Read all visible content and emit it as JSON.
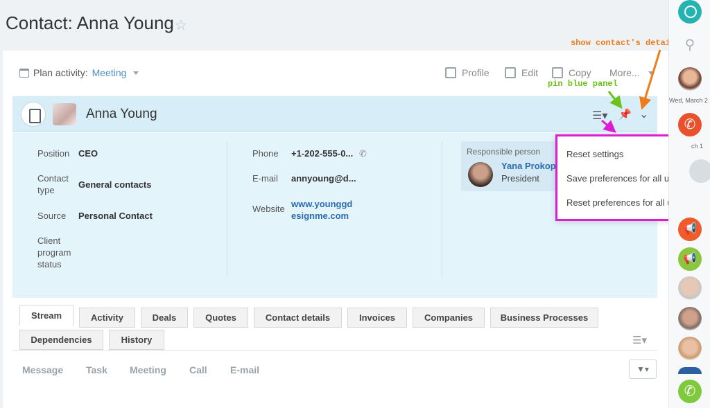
{
  "page": {
    "title": "Contact: Anna Young",
    "star_icon": "star-icon"
  },
  "toolbar": {
    "plan_prefix": "Plan activity:",
    "plan_value": "Meeting",
    "profile": "Profile",
    "edit": "Edit",
    "copy": "Copy",
    "more": "More..."
  },
  "annotations": {
    "show_details": "show contact's details",
    "pin_panel": "pin blue panel",
    "orange": "#f07b18",
    "green": "#6ac21b",
    "magenta": "#e01bd6"
  },
  "header": {
    "name": "Anna Young"
  },
  "details": {
    "position_label": "Position",
    "position_value": "CEO",
    "contact_type_label_1": "Contact",
    "contact_type_label_2": "type",
    "contact_type_value": "General contacts",
    "source_label": "Source",
    "source_value": "Personal Contact",
    "client_label_1": "Client",
    "client_label_2": "program",
    "client_label_3": "status",
    "phone_label": "Phone",
    "phone_value": "+1-202-555-0...",
    "email_label": "E-mail",
    "email_value": "annyoung@d...",
    "website_label": "Website",
    "website_value_1": "www.younggd",
    "website_value_2": "esignme.com",
    "responsible_title": "Responsible person",
    "responsible_name": "Yana Prokope",
    "responsible_position": "President"
  },
  "popup": {
    "items": [
      "Reset settings",
      "Save preferences for all users",
      "Reset preferences for all users"
    ]
  },
  "tabs": {
    "row1": [
      "Stream",
      "Activity",
      "Deals",
      "Quotes",
      "Contact details",
      "Invoices",
      "Companies",
      "Business Processes"
    ],
    "row2": [
      "Dependencies",
      "History"
    ]
  },
  "activity": {
    "items": [
      "Message",
      "Task",
      "Meeting",
      "Call",
      "E-mail"
    ]
  },
  "sidebar": {
    "date1": "Wed, March 2",
    "date2": "ch 1"
  }
}
